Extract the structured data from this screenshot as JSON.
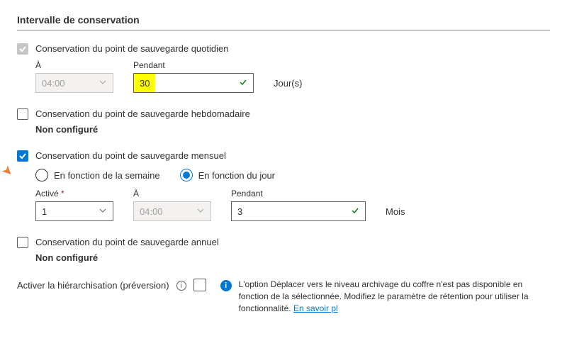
{
  "section_title": "Intervalle de conservation",
  "daily": {
    "label": "Conservation du point de sauvegarde quotidien",
    "at_label": "À",
    "at_value": "04:00",
    "for_label": "Pendant",
    "for_value": "30",
    "unit": "Jour(s)"
  },
  "weekly": {
    "label": "Conservation du point de sauvegarde hebdomadaire",
    "not_configured": "Non configuré"
  },
  "monthly": {
    "label": "Conservation du point de sauvegarde mensuel",
    "radio_week": "En fonction de la semaine",
    "radio_day": "En fonction du jour",
    "on_label": "Activé",
    "on_value": "1",
    "at_label": "À",
    "at_value": "04:00",
    "for_label": "Pendant",
    "for_value": "3",
    "unit": "Mois"
  },
  "yearly": {
    "label": "Conservation du point de sauvegarde annuel",
    "not_configured": "Non configuré"
  },
  "tiering": {
    "label": "Activer la hiérarchisation (préversion)",
    "info_text": "L'option Déplacer vers le niveau archivage du coffre n'est pas disponible en fonction de la sélectionnée. Modifiez le paramètre de rétention pour utiliser la fonctionnalité.",
    "link_text": "En savoir pl"
  }
}
